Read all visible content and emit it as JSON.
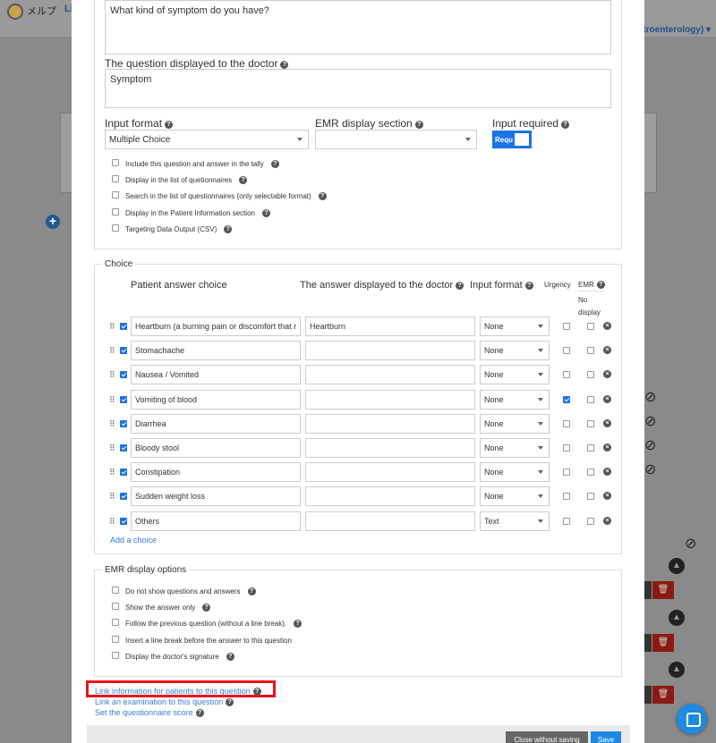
{
  "background": {
    "logo_text": "メルプ",
    "nav_text": "Li",
    "department_text": "stroenterology)"
  },
  "form": {
    "question_textarea_value": "What kind of symptom do you have?",
    "doctor_question_label": "The question displayed to the doctor",
    "doctor_question_value": "Symptom",
    "input_format_label": "Input format",
    "input_format_value": "Multiple Choice",
    "emr_section_label": "EMR display section",
    "emr_section_value": "",
    "input_required_label": "Input required",
    "input_required_toggle": "Requ",
    "options": [
      {
        "label": "Include this question and answer in the tally",
        "checked": false
      },
      {
        "label": "Display in the list of quetionnaires",
        "checked": false
      },
      {
        "label": "Search in the list of questionnaires (only selectable format)",
        "checked": false
      },
      {
        "label": "Display in the Patient Information section",
        "checked": false
      },
      {
        "label": "Targeting Data Output (CSV)",
        "checked": false
      }
    ]
  },
  "choice": {
    "legend": "Choice",
    "headers": {
      "patient_answer": "Patient answer choice",
      "doctor_answer": "The answer displayed to the doctor",
      "input_format": "Input format",
      "urgency": "Urgency",
      "emr": "EMR",
      "no_display": "No display"
    },
    "rows": [
      {
        "patient": "Heartburn (a burning pain or discomfort that r",
        "doctor": "Heartburn",
        "format": "None",
        "urgency": false,
        "emr": false
      },
      {
        "patient": "Stomachache",
        "doctor": "",
        "format": "None",
        "urgency": false,
        "emr": false
      },
      {
        "patient": "Nausea / Vomited",
        "doctor": "",
        "format": "None",
        "urgency": false,
        "emr": false
      },
      {
        "patient": "Vomiting of blood",
        "doctor": "",
        "format": "None",
        "urgency": true,
        "emr": false
      },
      {
        "patient": "Diarrhea",
        "doctor": "",
        "format": "None",
        "urgency": false,
        "emr": false
      },
      {
        "patient": "Bloody stool",
        "doctor": "",
        "format": "None",
        "urgency": false,
        "emr": false
      },
      {
        "patient": "Constipation",
        "doctor": "",
        "format": "None",
        "urgency": false,
        "emr": false
      },
      {
        "patient": "Sudden weight loss",
        "doctor": "",
        "format": "None",
        "urgency": false,
        "emr": false
      },
      {
        "patient": "Others",
        "doctor": "",
        "format": "Text",
        "urgency": false,
        "emr": false
      }
    ],
    "add_choice": "Add a choice"
  },
  "emr_options": {
    "legend": "EMR display options",
    "items": [
      {
        "label": "Do not show questions and answers"
      },
      {
        "label": "Show the answer only"
      },
      {
        "label": "Follow the previous question (without a line break)."
      },
      {
        "label": "Insert a line break before the answer to this question"
      },
      {
        "label": "Display the doctor's signature"
      }
    ]
  },
  "links": {
    "link_info": "Link information for patients to this question",
    "link_exam": "Link an examination to this question",
    "set_score": "Set the questionnaire score"
  },
  "footer": {
    "close_label": "Close without saving",
    "save_label": "Save"
  },
  "colors": {
    "accent": "#1a73e8",
    "highlight": "#e8141a",
    "link": "#3a7bd5"
  }
}
